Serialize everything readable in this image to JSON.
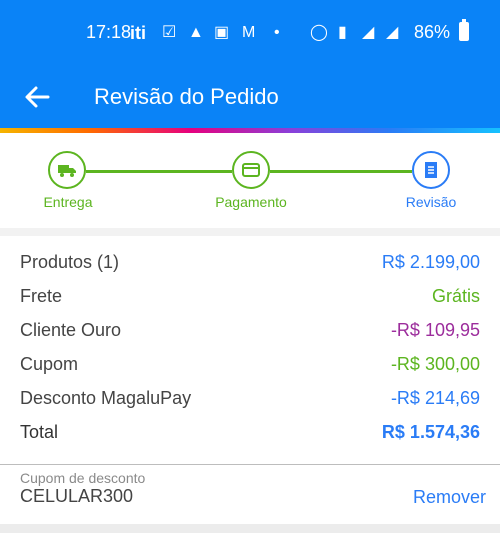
{
  "status": {
    "time": "17:18",
    "battery": "86%"
  },
  "header": {
    "title": "Revisão do Pedido"
  },
  "colors": {
    "brand": "#0a83f7",
    "green": "#5cb520",
    "blue": "#2a7cf6",
    "purple": "#9c2d9c"
  },
  "steps": [
    {
      "label": "Entrega",
      "icon": "truck-icon"
    },
    {
      "label": "Pagamento",
      "icon": "card-icon"
    },
    {
      "label": "Revisão",
      "icon": "receipt-icon"
    }
  ],
  "summary": [
    {
      "label": "Produtos (1)",
      "value": "R$ 2.199,00",
      "color": "#2a7cf6"
    },
    {
      "label": "Frete",
      "value": "Grátis",
      "color": "#5cb520"
    },
    {
      "label": "Cliente Ouro",
      "value": "-R$ 109,95",
      "color": "#9c2d9c"
    },
    {
      "label": "Cupom",
      "value": "-R$ 300,00",
      "color": "#5cb520"
    },
    {
      "label": "Desconto MagaluPay",
      "value": "-R$ 214,69",
      "color": "#2a7cf6"
    },
    {
      "label": "Total",
      "value": "R$ 1.574,36",
      "color": "#2a7cf6"
    }
  ],
  "coupon": {
    "label": "Cupom de desconto",
    "code": "CELULAR300",
    "remove_label": "Remover"
  }
}
